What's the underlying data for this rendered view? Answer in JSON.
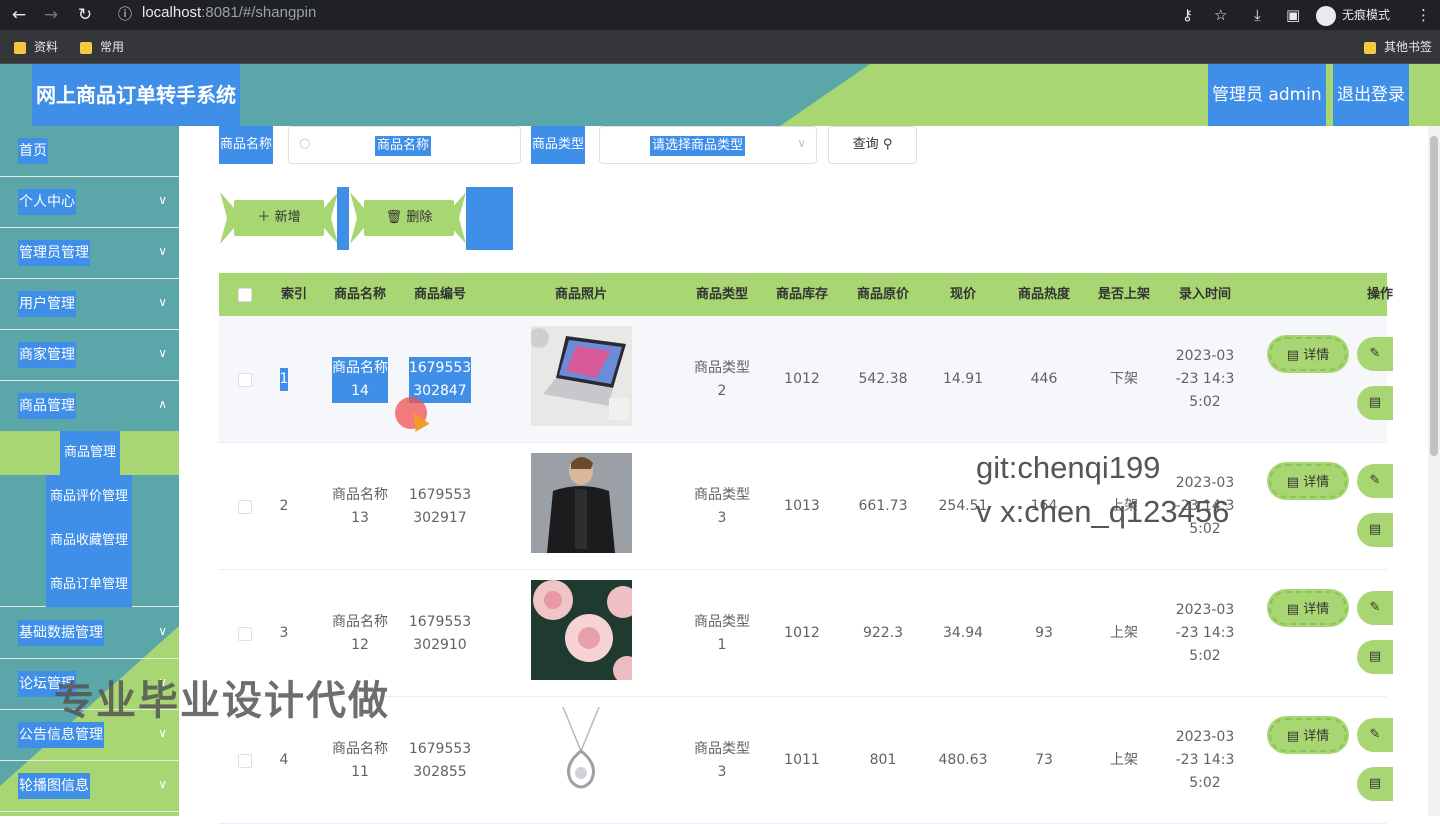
{
  "browser": {
    "url_host": "localhost",
    "url_port_path": ":8081/#/shangpin",
    "incognito_label": "无痕模式",
    "bookmarks": [
      "资料",
      "常用"
    ],
    "other_bookmarks": "其他书签"
  },
  "header": {
    "title": "网上商品订单转手系统",
    "admin": "管理员 admin",
    "logout": "退出登录"
  },
  "sidebar": {
    "items": [
      {
        "label": "首页",
        "has_arrow": false
      },
      {
        "label": "个人中心",
        "has_arrow": true
      },
      {
        "label": "管理员管理",
        "has_arrow": true
      },
      {
        "label": "用户管理",
        "has_arrow": true
      },
      {
        "label": "商家管理",
        "has_arrow": true
      },
      {
        "label": "商品管理",
        "has_arrow": true
      }
    ],
    "sub_items": [
      "商品管理",
      "商品评价管理",
      "商品收藏管理",
      "商品订单管理"
    ],
    "items_after": [
      {
        "label": "基础数据管理"
      },
      {
        "label": "论坛管理"
      },
      {
        "label": "公告信息管理"
      },
      {
        "label": "轮播图信息"
      }
    ]
  },
  "search": {
    "name_label": "商品名称",
    "name_placeholder": "商品名称",
    "type_label": "商品类型",
    "type_placeholder": "请选择商品类型",
    "query_button": "查询"
  },
  "actions": {
    "add": "新增",
    "delete": "删除"
  },
  "table": {
    "headers": [
      "索引",
      "商品名称",
      "商品编号",
      "商品照片",
      "商品类型",
      "商品库存",
      "商品原价",
      "现价",
      "商品热度",
      "是否上架",
      "录入时间",
      "操作"
    ],
    "rows": [
      {
        "index": "1",
        "name_line1": "商品名称",
        "name_line2": "14",
        "code_line1": "1679553",
        "code_line2": "302847",
        "type_line1": "商品类型",
        "type_line2": "2",
        "stock": "1012",
        "orig_price": "542.38",
        "price": "14.91",
        "heat": "446",
        "status": "下架",
        "time_line1": "2023-03",
        "time_line2": "-23 14:3",
        "time_line3": "5:02"
      },
      {
        "index": "2",
        "name_line1": "商品名称",
        "name_line2": "13",
        "code_line1": "1679553",
        "code_line2": "302917",
        "type_line1": "商品类型",
        "type_line2": "3",
        "stock": "1013",
        "orig_price": "661.73",
        "price": "254.51",
        "heat": "164",
        "status": "上架",
        "time_line1": "2023-03",
        "time_line2": "-23 14:3",
        "time_line3": "5:02"
      },
      {
        "index": "3",
        "name_line1": "商品名称",
        "name_line2": "12",
        "code_line1": "1679553",
        "code_line2": "302910",
        "type_line1": "商品类型",
        "type_line2": "1",
        "stock": "1012",
        "orig_price": "922.3",
        "price": "34.94",
        "heat": "93",
        "status": "上架",
        "time_line1": "2023-03",
        "time_line2": "-23 14:3",
        "time_line3": "5:02"
      },
      {
        "index": "4",
        "name_line1": "商品名称",
        "name_line2": "11",
        "code_line1": "1679553",
        "code_line2": "302855",
        "type_line1": "商品类型",
        "type_line2": "3",
        "stock": "1011",
        "orig_price": "801",
        "price": "480.63",
        "heat": "73",
        "status": "上架",
        "time_line1": "2023-03",
        "time_line2": "-23 14:3",
        "time_line3": "5:02"
      }
    ],
    "detail_label": "详情"
  },
  "overlay": {
    "git": "git:chenqi199",
    "vx": "v x:chen_q123456",
    "watermark": "专业毕业设计代做"
  }
}
